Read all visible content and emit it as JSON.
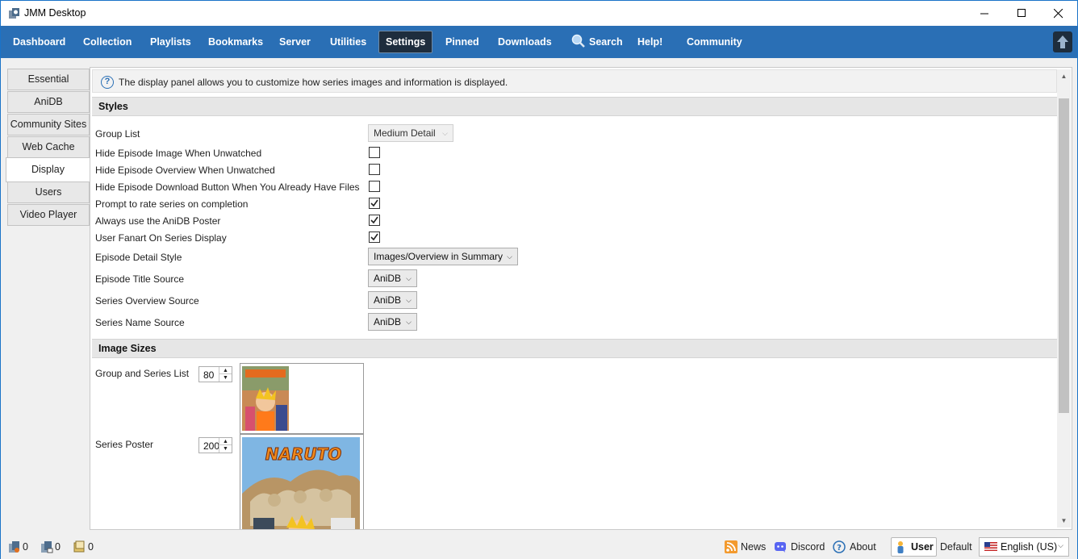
{
  "window": {
    "title": "JMM Desktop"
  },
  "nav": {
    "items": [
      {
        "label": "Dashboard"
      },
      {
        "label": "Collection"
      },
      {
        "label": "Playlists"
      },
      {
        "label": "Bookmarks"
      },
      {
        "label": "Server"
      },
      {
        "label": "Utilities"
      },
      {
        "label": "Settings",
        "active": true
      },
      {
        "label": "Pinned"
      },
      {
        "label": "Downloads"
      },
      {
        "label": "Search",
        "icon": "search-icon"
      },
      {
        "label": "Help!"
      },
      {
        "label": "Community"
      }
    ]
  },
  "settings_tabs": [
    {
      "label": "Essential"
    },
    {
      "label": "AniDB"
    },
    {
      "label": "Community Sites"
    },
    {
      "label": "Web Cache"
    },
    {
      "label": "Display",
      "active": true
    },
    {
      "label": "Users"
    },
    {
      "label": "Video Player"
    }
  ],
  "info": {
    "text": "The display panel allows you to customize how series images and information is displayed."
  },
  "styles": {
    "heading": "Styles",
    "group_list": {
      "label": "Group List",
      "value": "Medium Detail"
    },
    "checks": [
      {
        "label": "Hide Episode Image When Unwatched",
        "checked": false
      },
      {
        "label": "Hide Episode Overview When Unwatched",
        "checked": false
      },
      {
        "label": "Hide Episode Download Button When You Already Have Files",
        "checked": false
      },
      {
        "label": "Prompt to rate series on completion",
        "checked": true
      },
      {
        "label": "Always use the AniDB Poster",
        "checked": true
      },
      {
        "label": "User Fanart On Series Display",
        "checked": true
      }
    ],
    "episode_detail_style": {
      "label": "Episode Detail Style",
      "value": "Images/Overview in Summary"
    },
    "episode_title_source": {
      "label": "Episode Title Source",
      "value": "AniDB"
    },
    "series_overview_source": {
      "label": "Series Overview Source",
      "value": "AniDB"
    },
    "series_name_source": {
      "label": "Series Name Source",
      "value": "AniDB"
    }
  },
  "image_sizes": {
    "heading": "Image Sizes",
    "group_series_list": {
      "label": "Group and Series List",
      "value": "80"
    },
    "series_poster": {
      "label": "Series Poster",
      "value": "200"
    },
    "poster_logo_text": "NARUTO"
  },
  "status": {
    "hasher_count": "0",
    "file_count": "0",
    "import_count": "0",
    "news": "News",
    "discord": "Discord",
    "about": "About",
    "user": "User",
    "default": "Default",
    "language": "English (US)"
  },
  "colors": {
    "nav_bg": "#2a6fb5",
    "active_nav": "#1e2d3d",
    "accent": "#1a73c8"
  }
}
